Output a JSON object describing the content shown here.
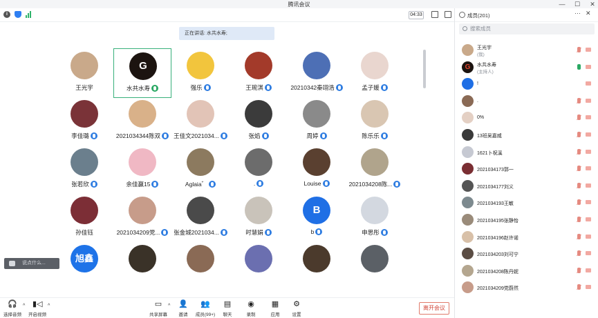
{
  "window": {
    "title": "腾讯会议"
  },
  "topbar": {
    "timer": "04:33"
  },
  "speaking": {
    "text": "正在讲话: 水共水寿;"
  },
  "grid": [
    {
      "name": "王光宇",
      "badge": false,
      "active": false,
      "color": "#c9a98a"
    },
    {
      "name": "水共水寿",
      "badge": true,
      "badge_active": true,
      "active": true,
      "color": "#1c1410",
      "letter": "G"
    },
    {
      "name": "强乐",
      "badge": true,
      "active": false,
      "color": "#f2c53d"
    },
    {
      "name": "王琬淇",
      "badge": true,
      "active": false,
      "color": "#a33a2a"
    },
    {
      "name": "20210342秦翊浩",
      "badge": true,
      "active": false,
      "color": "#4d6fb5"
    },
    {
      "name": "孟子媛",
      "badge": true,
      "active": false,
      "color": "#e9d6cf"
    },
    {
      "name": "李佳璐",
      "badge": true,
      "active": false,
      "color": "#7a3338"
    },
    {
      "name": "2021034344陈双",
      "badge": true,
      "active": false,
      "color": "#d9b189"
    },
    {
      "name": "王佳文2021034...",
      "badge": true,
      "active": false,
      "color": "#e2c4b7"
    },
    {
      "name": "张焰",
      "badge": true,
      "active": false,
      "color": "#3b3b3b"
    },
    {
      "name": "周婷",
      "badge": true,
      "active": false,
      "color": "#8a8a8a"
    },
    {
      "name": "陈乐乐",
      "badge": true,
      "active": false,
      "color": "#d9c6b2"
    },
    {
      "name": "张若欣",
      "badge": true,
      "active": false,
      "color": "#6b7f8d"
    },
    {
      "name": "余佳赢15",
      "badge": true,
      "active": false,
      "color": "#f0b8c4"
    },
    {
      "name": "Aglaia゛",
      "badge": true,
      "active": false,
      "color": "#8c7a5f"
    },
    {
      "name": ".",
      "badge": true,
      "active": false,
      "color": "#6c6c6c"
    },
    {
      "name": "Louise",
      "badge": true,
      "active": false,
      "color": "#5a4030"
    },
    {
      "name": "2021034208陈...",
      "badge": true,
      "active": false,
      "color": "#b0a48c"
    },
    {
      "name": "孙佳钰",
      "badge": false,
      "active": false,
      "color": "#7c2e36"
    },
    {
      "name": "2021034209党...",
      "badge": true,
      "active": false,
      "color": "#c79c8a"
    },
    {
      "name": "张金城2021034...",
      "badge": true,
      "active": false,
      "color": "#4a4a4a"
    },
    {
      "name": "时慧娟",
      "badge": true,
      "active": false,
      "color": "#c9c3ba"
    },
    {
      "name": "b",
      "badge": true,
      "active": false,
      "color": "#1f6fe5",
      "letter": "B"
    },
    {
      "name": "申思彤",
      "badge": true,
      "active": false,
      "color": "#d3d8e0"
    },
    {
      "name": "",
      "badge": false,
      "active": false,
      "color": "#1e73e8",
      "letter": "旭鑫"
    },
    {
      "name": "",
      "badge": false,
      "active": false,
      "color": "#3a3228"
    },
    {
      "name": "",
      "badge": false,
      "active": false,
      "color": "#8a6a55"
    },
    {
      "name": "",
      "badge": false,
      "active": false,
      "color": "#6b6fb0"
    },
    {
      "name": "",
      "badge": false,
      "active": false,
      "color": "#4b3a2c"
    },
    {
      "name": "",
      "badge": false,
      "active": false,
      "color": "#5b6066"
    }
  ],
  "chat_input": {
    "placeholder": "说点什么..."
  },
  "bottombar": {
    "audio": "选择音频",
    "video": "开启视频",
    "share": "共享屏幕",
    "invite": "邀请",
    "members": "成员(99+)",
    "chat": "聊天",
    "record": "录制",
    "apps": "应用",
    "settings": "设置",
    "leave": "离开会议"
  },
  "panel": {
    "title": "成员(201)",
    "search_placeholder": "搜索成员",
    "members": [
      {
        "name": "王光宇",
        "role": "(我)",
        "mic": "muted",
        "color": "#c9a98a"
      },
      {
        "name": "水共水寿",
        "role": "(主持人)",
        "mic": "on",
        "color": "#1c1410",
        "letter": "G"
      },
      {
        "name": "!",
        "role": "",
        "mic": "none",
        "color": "#1f6fe5"
      },
      {
        "name": ".",
        "role": "",
        "mic": "muted",
        "color": "#8a6a55"
      },
      {
        "name": "0%",
        "role": "",
        "mic": "muted",
        "color": "#e4d0c4"
      },
      {
        "name": "13班吴嘉威",
        "role": "",
        "mic": "muted",
        "color": "#3a3a3a"
      },
      {
        "name": "1621卜祝溪",
        "role": "",
        "mic": "muted",
        "color": "#c6c9d2"
      },
      {
        "name": "2021034173郭一",
        "role": "",
        "mic": "muted",
        "color": "#7a2e33"
      },
      {
        "name": "2021034177刘义",
        "role": "",
        "mic": "muted",
        "color": "#555555"
      },
      {
        "name": "2021034193王敏",
        "role": "",
        "mic": "muted",
        "color": "#7d8a8f"
      },
      {
        "name": "2021034195张静怡",
        "role": "",
        "mic": "muted",
        "color": "#9a8b7a"
      },
      {
        "name": "2021034196赵许诺",
        "role": "",
        "mic": "muted",
        "color": "#d8c0a8"
      },
      {
        "name": "2021034203刘可宁",
        "role": "",
        "mic": "muted",
        "color": "#5b4d44"
      },
      {
        "name": "2021034208陈丹妮",
        "role": "",
        "mic": "muted",
        "color": "#b4a68f"
      },
      {
        "name": "2021034209党蔚然",
        "role": "",
        "mic": "muted",
        "color": "#c79c8a"
      }
    ]
  }
}
